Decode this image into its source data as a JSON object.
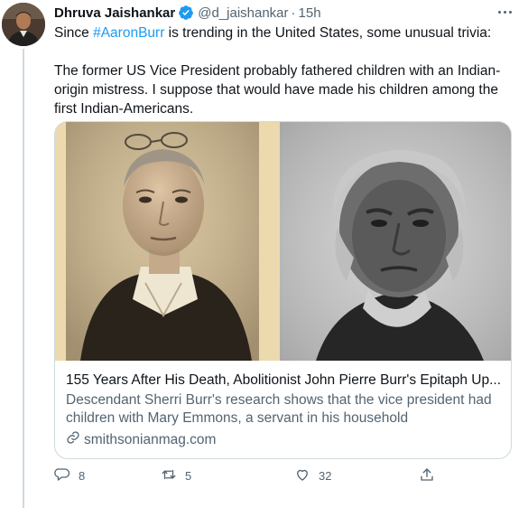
{
  "author": {
    "name": "Dhruva Jaishankar",
    "handle": "@d_jaishankar",
    "separator": "·",
    "time": "15h",
    "verified": true
  },
  "tweet": {
    "line1_prefix": "Since ",
    "hashtag": "#AaronBurr",
    "line1_suffix": " is trending in the United States, some unusual trivia:",
    "paragraph2": "The former US Vice President probably fathered children with an Indian-origin mistress. I suppose that would have made his children among the first Indian-Americans."
  },
  "card": {
    "title": "155 Years After His Death, Abolitionist John Pierre Burr's Epitaph Up...",
    "description": "Descendant Sherri Burr's research shows that the vice president had children with Mary Emmons, a servant in his household",
    "domain": "smithsonianmag.com"
  },
  "actions": {
    "replies": "8",
    "retweets": "5",
    "likes": "32"
  },
  "colors": {
    "accent": "#1d9bf0",
    "secondary_text": "#536471",
    "border": "#cfd9de"
  },
  "icons": [
    "verified-badge-icon",
    "more-icon",
    "link-icon",
    "reply-icon",
    "retweet-icon",
    "like-icon",
    "share-icon"
  ]
}
